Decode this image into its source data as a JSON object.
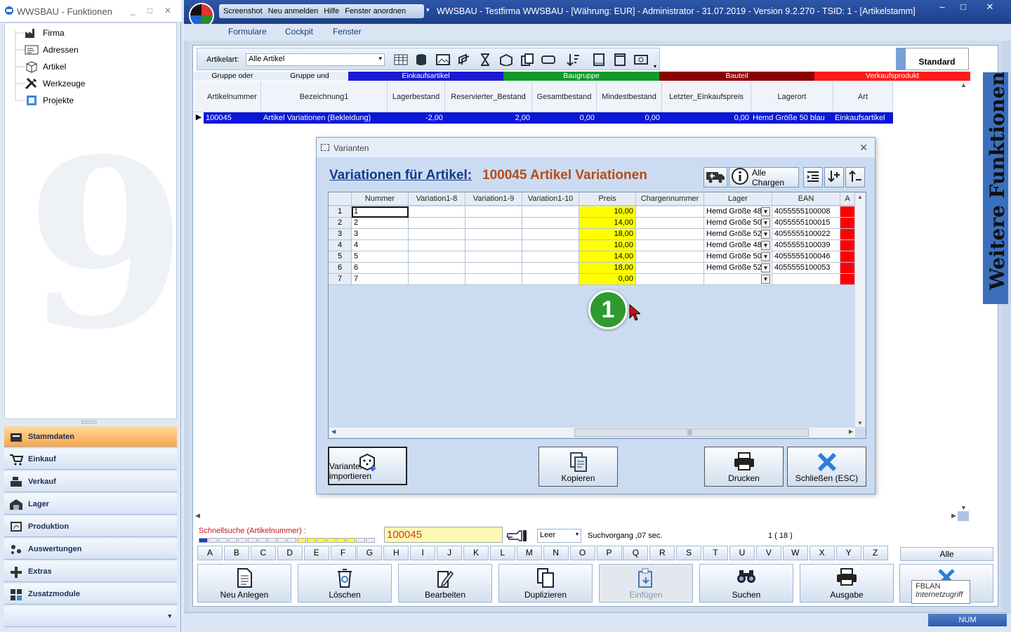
{
  "left_panel": {
    "title": "WWSBAU - Funktionen",
    "tree": [
      {
        "label": "Firma",
        "icon": "factory-icon"
      },
      {
        "label": "Adressen",
        "icon": "address-card-icon"
      },
      {
        "label": "Artikel",
        "icon": "box-icon"
      },
      {
        "label": "Werkzeuge",
        "icon": "tools-icon"
      },
      {
        "label": "Projekte",
        "icon": "project-icon"
      }
    ],
    "nav": [
      {
        "label": "Stammdaten",
        "icon": "master-data-icon"
      },
      {
        "label": "Einkauf",
        "icon": "cart-icon"
      },
      {
        "label": "Verkauf",
        "icon": "cash-register-icon"
      },
      {
        "label": "Lager",
        "icon": "warehouse-icon"
      },
      {
        "label": "Produktion",
        "icon": "production-icon"
      },
      {
        "label": "Auswertungen",
        "icon": "analysis-icon"
      },
      {
        "label": "Extras",
        "icon": "extras-icon"
      },
      {
        "label": "Zusatzmodule",
        "icon": "modules-icon"
      }
    ]
  },
  "window": {
    "quick_items": [
      "Screenshot",
      "Neu anmelden",
      "Hilfe",
      "Fenster anordnen"
    ],
    "title": "WWSBAU - Testfirma WWSBAU - [Währung: EUR] - Administrator - 31.07.2019 - Version 9.2.270 - TSID: 1 - [Artikelstamm]",
    "menu": [
      "Formulare",
      "Cockpit",
      "Fenster"
    ]
  },
  "toolbar": {
    "artikelart_label": "Artikelart:",
    "artikelart_value": "Alle Artikel",
    "standard_label": "Standard"
  },
  "filters": [
    {
      "label": "Gruppe oder",
      "color": "#e8eef8",
      "text": "#000000"
    },
    {
      "label": "Gruppe und",
      "color": "#e8eef8",
      "text": "#000000"
    },
    {
      "label": "Einkaufsartikel",
      "color": "#1a1ad6",
      "text": "#ffffff"
    },
    {
      "label": "Baugruppe",
      "color": "#109a2a",
      "text": "#ffffff"
    },
    {
      "label": "Bauteil",
      "color": "#8b0000",
      "text": "#ffffff"
    },
    {
      "label": "Verkaufsprodukt",
      "color": "#ff1a1a",
      "text": "#ffffff"
    }
  ],
  "main_grid": {
    "columns": [
      "Artikelnummer",
      "Bezeichnung1",
      "Lagerbestand",
      "Reservierter_Bestand",
      "Gesamtbestand",
      "Mindestbestand",
      "Letzter_Einkaufspreis",
      "Lagerort",
      "Art"
    ],
    "row": [
      "100045",
      "Artikel Variationen (Bekleidung)",
      "-2,00",
      "2,00",
      "0,00",
      "0,00",
      "0,00",
      "Hemd Größe 50 blau",
      "Einkaufsartikel"
    ]
  },
  "dialog": {
    "title": "Varianten",
    "heading_label": "Variationen für Artikel:",
    "heading_value": "100045  Artikel Variationen",
    "alle_chargen": "Alle Chargen",
    "columns": [
      "Nummer",
      "Variation1-8",
      "Variation1-9",
      "Variation1-10",
      "Preis",
      "Chargennummer",
      "Lager",
      "EAN",
      "A"
    ],
    "rows": [
      {
        "n": "1",
        "nummer": "1",
        "preis": "10,00",
        "lager": "Hemd Größe 48",
        "ean": "4055555100008"
      },
      {
        "n": "2",
        "nummer": "2",
        "preis": "14,00",
        "lager": "Hemd Größe 50",
        "ean": "4055555100015"
      },
      {
        "n": "3",
        "nummer": "3",
        "preis": "18,00",
        "lager": "Hemd Größe 52",
        "ean": "4055555100022"
      },
      {
        "n": "4",
        "nummer": "4",
        "preis": "10,00",
        "lager": "Hemd Größe 48",
        "ean": "4055555100039"
      },
      {
        "n": "5",
        "nummer": "5",
        "preis": "14,00",
        "lager": "Hemd Größe 50",
        "ean": "4055555100046"
      },
      {
        "n": "6",
        "nummer": "6",
        "preis": "18,00",
        "lager": "Hemd Größe 52",
        "ean": "4055555100053"
      },
      {
        "n": "7",
        "nummer": "7",
        "preis": "0,00",
        "lager": "",
        "ean": ""
      }
    ],
    "badge": "1",
    "buttons": {
      "import": "Varianten importieren",
      "copy": "Kopieren",
      "print": "Drucken",
      "close": "Schließen (ESC)"
    }
  },
  "search": {
    "label": "Schnellsuche (Artikelnummer) :",
    "value": "100045",
    "mode": "Leer",
    "time": "Suchvorgang ,07 sec.",
    "count": "1 ( 18 )"
  },
  "letters": [
    "A",
    "B",
    "C",
    "D",
    "E",
    "F",
    "G",
    "H",
    "I",
    "J",
    "K",
    "L",
    "M",
    "N",
    "O",
    "P",
    "Q",
    "R",
    "S",
    "T",
    "U",
    "V",
    "W",
    "X",
    "Y",
    "Z"
  ],
  "alle_label": "Alle",
  "actions": [
    {
      "label": "Neu Anlegen",
      "icon": "new-document-icon"
    },
    {
      "label": "Löschen",
      "icon": "recycle-bin-icon"
    },
    {
      "label": "Bearbeiten",
      "icon": "edit-icon"
    },
    {
      "label": "Duplizieren",
      "icon": "duplicate-icon"
    },
    {
      "label": "Einfügen",
      "icon": "paste-icon"
    },
    {
      "label": "Suchen",
      "icon": "binoculars-icon"
    },
    {
      "label": "Ausgabe",
      "icon": "printer-icon"
    }
  ],
  "tooltip": {
    "title": "FBLAN",
    "subtitle": "Internetzugriff"
  },
  "status": {
    "num": "NUM"
  },
  "side_tab": "Weitere Funktionen"
}
